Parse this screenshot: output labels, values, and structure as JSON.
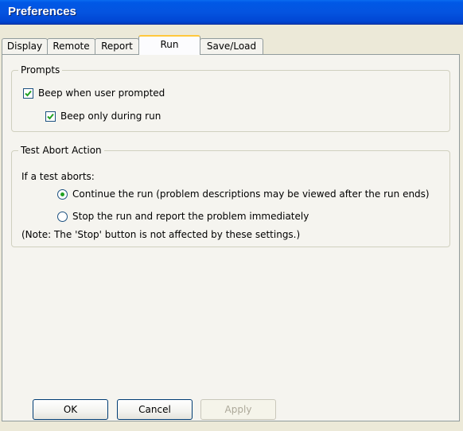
{
  "window": {
    "title": "Preferences"
  },
  "tabs": [
    {
      "label": "Display"
    },
    {
      "label": "Remote"
    },
    {
      "label": "Report"
    },
    {
      "label": "Run",
      "active": true
    },
    {
      "label": "Save/Load"
    }
  ],
  "prompts": {
    "legend": "Prompts",
    "beep_prompted": {
      "label": "Beep when user prompted",
      "checked": true
    },
    "beep_run": {
      "label": "Beep only during run",
      "checked": true
    }
  },
  "abort": {
    "legend": "Test Abort Action",
    "intro": "If a test aborts:",
    "options": [
      {
        "label": "Continue the run (problem descriptions may be viewed after the run ends)",
        "selected": true
      },
      {
        "label": "Stop the run and report the problem immediately",
        "selected": false
      }
    ],
    "note": "(Note: The 'Stop' button is not affected by these settings.)"
  },
  "buttons": {
    "ok": "OK",
    "cancel": "Cancel",
    "apply": "Apply"
  },
  "colors": {
    "titlebar": "#0454e0",
    "active_tab_highlight": "#ffc83c",
    "radio_dot": "#21a121"
  }
}
